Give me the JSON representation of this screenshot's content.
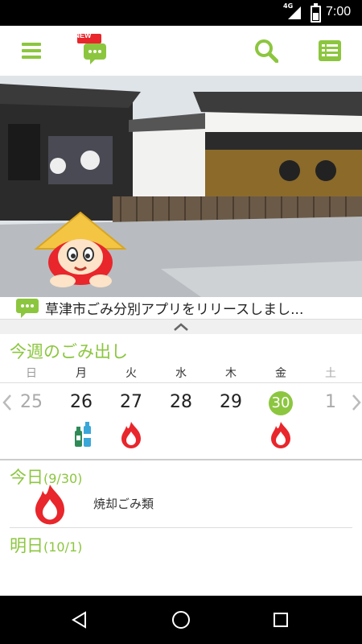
{
  "status_bar": {
    "network": "4G",
    "time": "7:00"
  },
  "app_bar": {
    "new_badge": "NEW"
  },
  "news": {
    "text": "草津市ごみ分別アプリをリリースしまし..."
  },
  "week": {
    "title": "今週のごみ出し",
    "days": [
      "日",
      "月",
      "火",
      "水",
      "木",
      "金",
      "土"
    ],
    "dates": [
      "25",
      "26",
      "27",
      "28",
      "29",
      "30",
      "1"
    ],
    "today_index": 5
  },
  "today": {
    "label": "今日",
    "date": "(9/30)",
    "item": "焼却ごみ類"
  },
  "tomorrow": {
    "label": "明日",
    "date": "(10/1)"
  },
  "colors": {
    "accent": "#8cc63f",
    "fire": "#e8262b",
    "bottle_green": "#2e8b57",
    "bottle_blue": "#3aa7d9"
  },
  "icons": [
    "menu-icon",
    "news-chat-icon",
    "search-icon",
    "list-icon",
    "fire-icon",
    "bottle-icon"
  ]
}
